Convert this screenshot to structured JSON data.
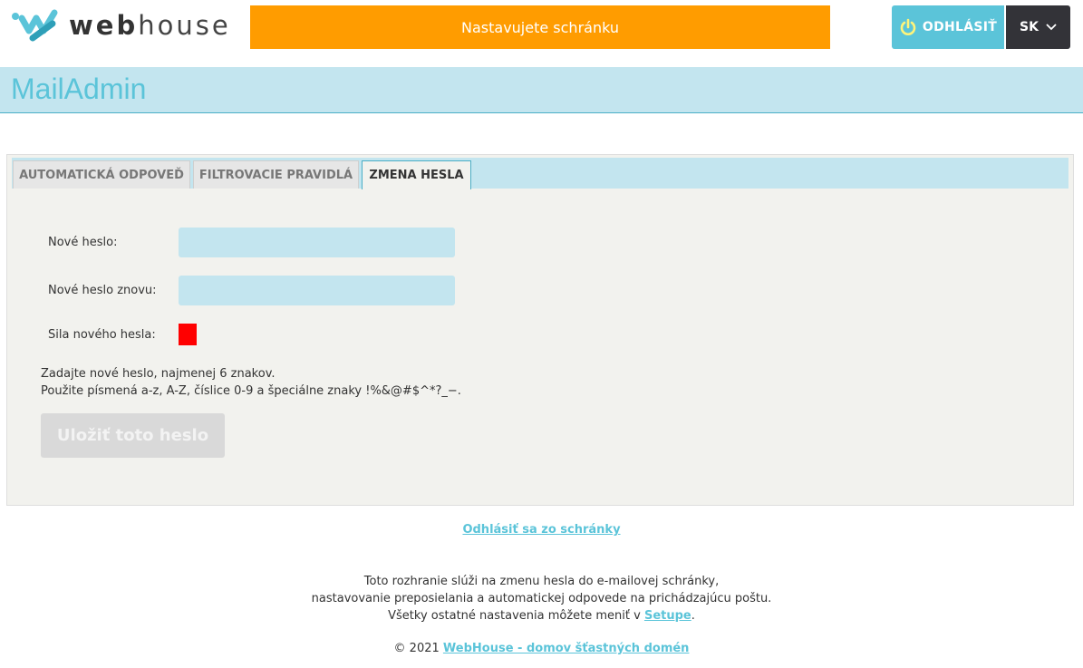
{
  "header": {
    "logo_text_bold": "web",
    "logo_text_regular": "house",
    "banner_text": "Nastavujete schránku",
    "logout_label": "ODHLÁSIŤ",
    "language_label": "SK",
    "colors": {
      "banner": "#ff9c00",
      "logout": "#5bc4d9",
      "lang": "#333338"
    }
  },
  "app": {
    "title": "MailAdmin"
  },
  "tabs": [
    {
      "label": "AUTOMATICKÁ ODPOVEĎ",
      "active": false
    },
    {
      "label": "FILTROVACIE PRAVIDLÁ",
      "active": false
    },
    {
      "label": "ZMENA HESLA",
      "active": true
    }
  ],
  "form": {
    "new_password_label": "Nové heslo:",
    "new_password_value": "",
    "repeat_password_label": "Nové heslo znovu:",
    "repeat_password_value": "",
    "strength_label": "Sila nového hesla:",
    "strength_color": "#ff0000",
    "hint_line1": "Zadajte nové heslo, najmenej 6 znakov.",
    "hint_line2": "Použite písmená a-z, A-Z, číslice 0-9 a špeciálne znaky !%&@#$^*?_−.",
    "save_label": "Uložiť toto heslo"
  },
  "footer": {
    "logout_link": "Odhlásiť sa zo schránky",
    "info_line1": "Toto rozhranie slúži na zmenu hesla do e-mailovej schránky,",
    "info_line2": "nastavovanie preposielania a automatickej odpovede na prichádzajúcu poštu.",
    "info_line3_prefix": "Všetky ostatné nastavenia môžete meniť v ",
    "info_line3_link": "Setupe",
    "info_line3_suffix": ".",
    "copyright_prefix": "© 2021 ",
    "copyright_link": "WebHouse - domov šťastných domén"
  }
}
